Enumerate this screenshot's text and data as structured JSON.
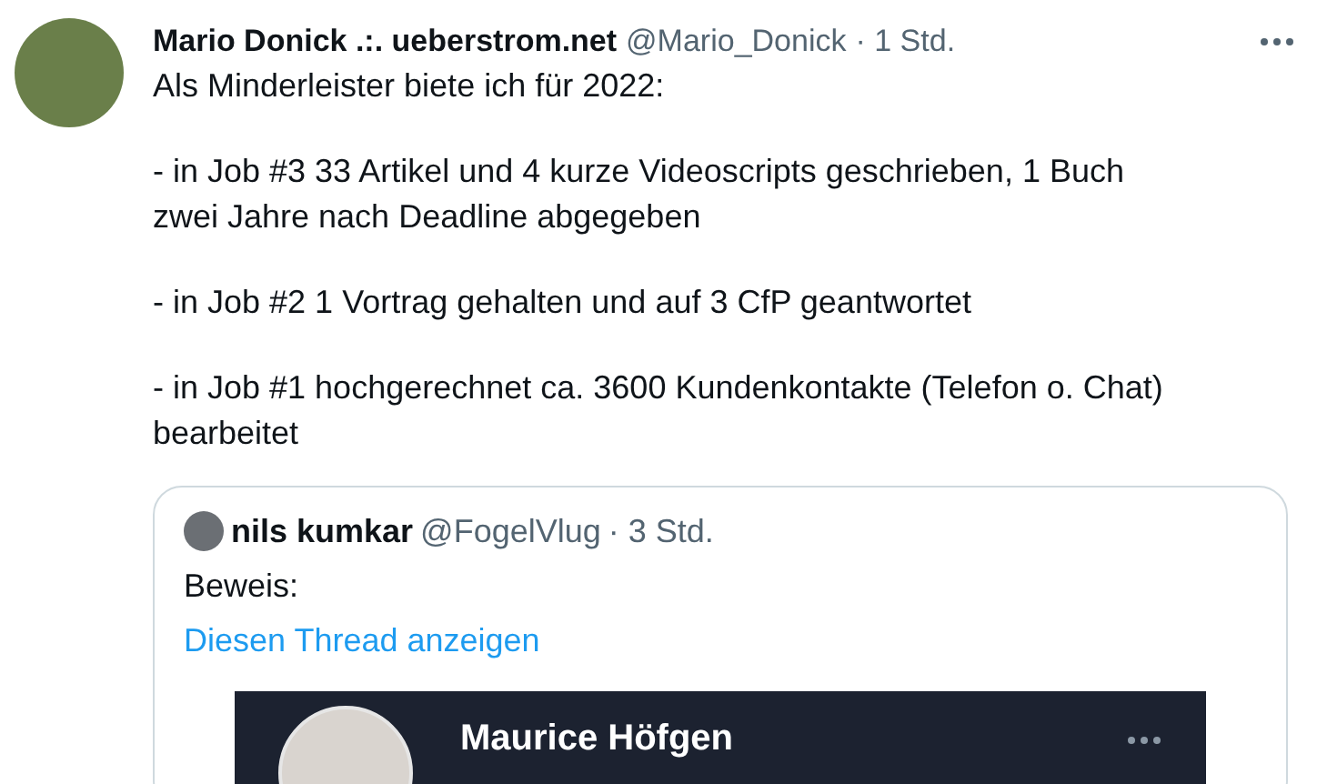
{
  "tweet": {
    "author": "Mario Donick .:. ueberstrom.net",
    "handle": "@Mario_Donick",
    "time": "· 1 Std.",
    "paragraphs": [
      "Als Minderleister biete ich für 2022:",
      "- in Job #3 33 Artikel und 4 kurze Videoscripts geschrieben, 1 Buch zwei Jahre nach Deadline abgegeben",
      "- in Job #2 1 Vortrag gehalten und auf 3 CfP geantwortet",
      "- in Job #1 hochgerechnet ca. 3600 Kundenkontakte (Telefon o. Chat) bearbeitet"
    ]
  },
  "quote": {
    "author": "nils kumkar",
    "handle": "@FogelVlug",
    "time": "· 3 Std.",
    "text": "Beweis:",
    "link": "Diesen Thread anzeigen",
    "image": {
      "name": "Maurice Höfgen"
    }
  }
}
